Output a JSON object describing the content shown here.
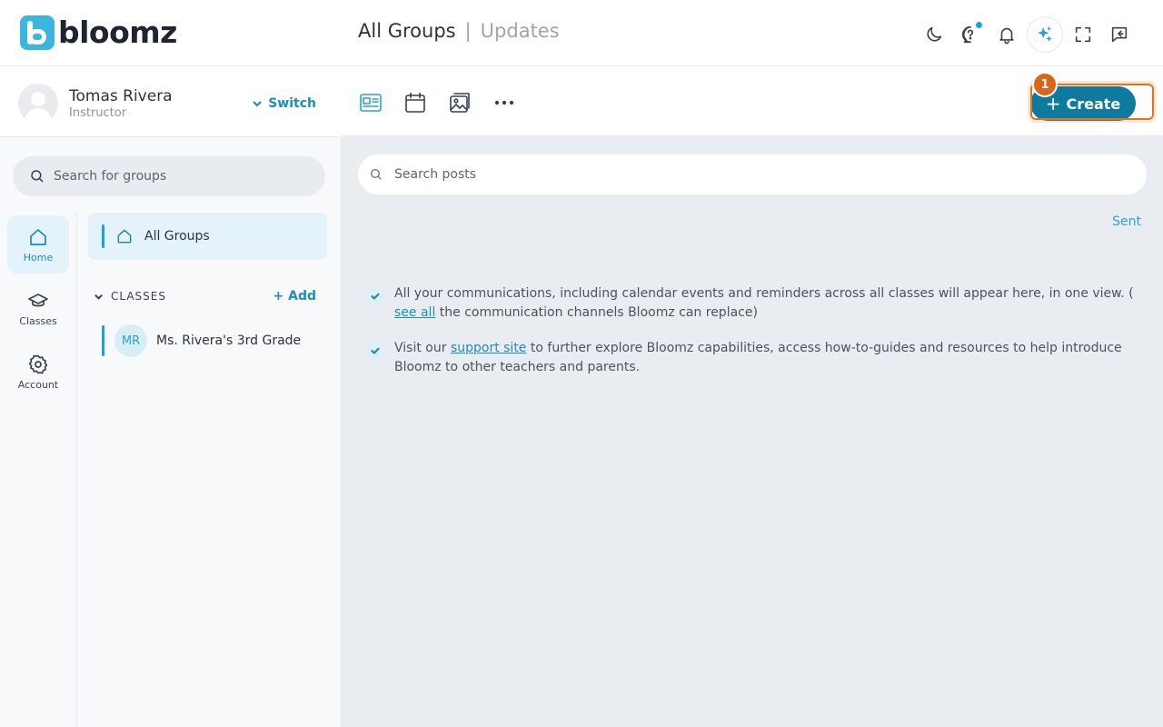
{
  "brand": {
    "name": "bloomz",
    "accent": "#1aa3d4",
    "logo_color": "#3ab6e0"
  },
  "header": {
    "crumb_active": "All Groups",
    "separator": "|",
    "crumb_inactive": "Updates",
    "icons": [
      "moon-icon",
      "help-chat-icon",
      "bell-icon",
      "ai-sparkle-icon",
      "fullscreen-icon",
      "feedback-icon"
    ]
  },
  "profile": {
    "name": "Tomas Rivera",
    "role": "Instructor",
    "switch_label": "Switch"
  },
  "group_search": {
    "placeholder": "Search for groups"
  },
  "rail": {
    "items": [
      {
        "label": "Home",
        "icon": "home-icon",
        "active": true
      },
      {
        "label": "Classes",
        "icon": "graduation-cap-icon",
        "active": false
      },
      {
        "label": "Account",
        "icon": "gear-icon",
        "active": false
      }
    ]
  },
  "groups": {
    "all_groups_label": "All Groups",
    "classes_heading": "CLASSES",
    "add_label": "+ Add",
    "classes": [
      {
        "initials": "MR",
        "name": "Ms. Rivera's 3rd Grade"
      }
    ]
  },
  "toolbar": {
    "tools": [
      "newsfeed-icon",
      "calendar-icon",
      "gallery-icon",
      "more-icon"
    ],
    "create_label": "Create",
    "marker_number": "1"
  },
  "main": {
    "post_search": {
      "placeholder": "Search posts"
    },
    "sent_label": "Sent",
    "info1": {
      "text_before": "All your communications, including calendar events and reminders across all classes will appear here, in one view. ( ",
      "link": "see all",
      "text_after": " the communication channels Bloomz can replace)"
    },
    "info2": {
      "text_before": "Visit our ",
      "link": "support site",
      "text_after": " to further explore Bloomz capabilities, access how-to-guides and resources to help introduce Bloomz to other teachers and parents."
    }
  }
}
